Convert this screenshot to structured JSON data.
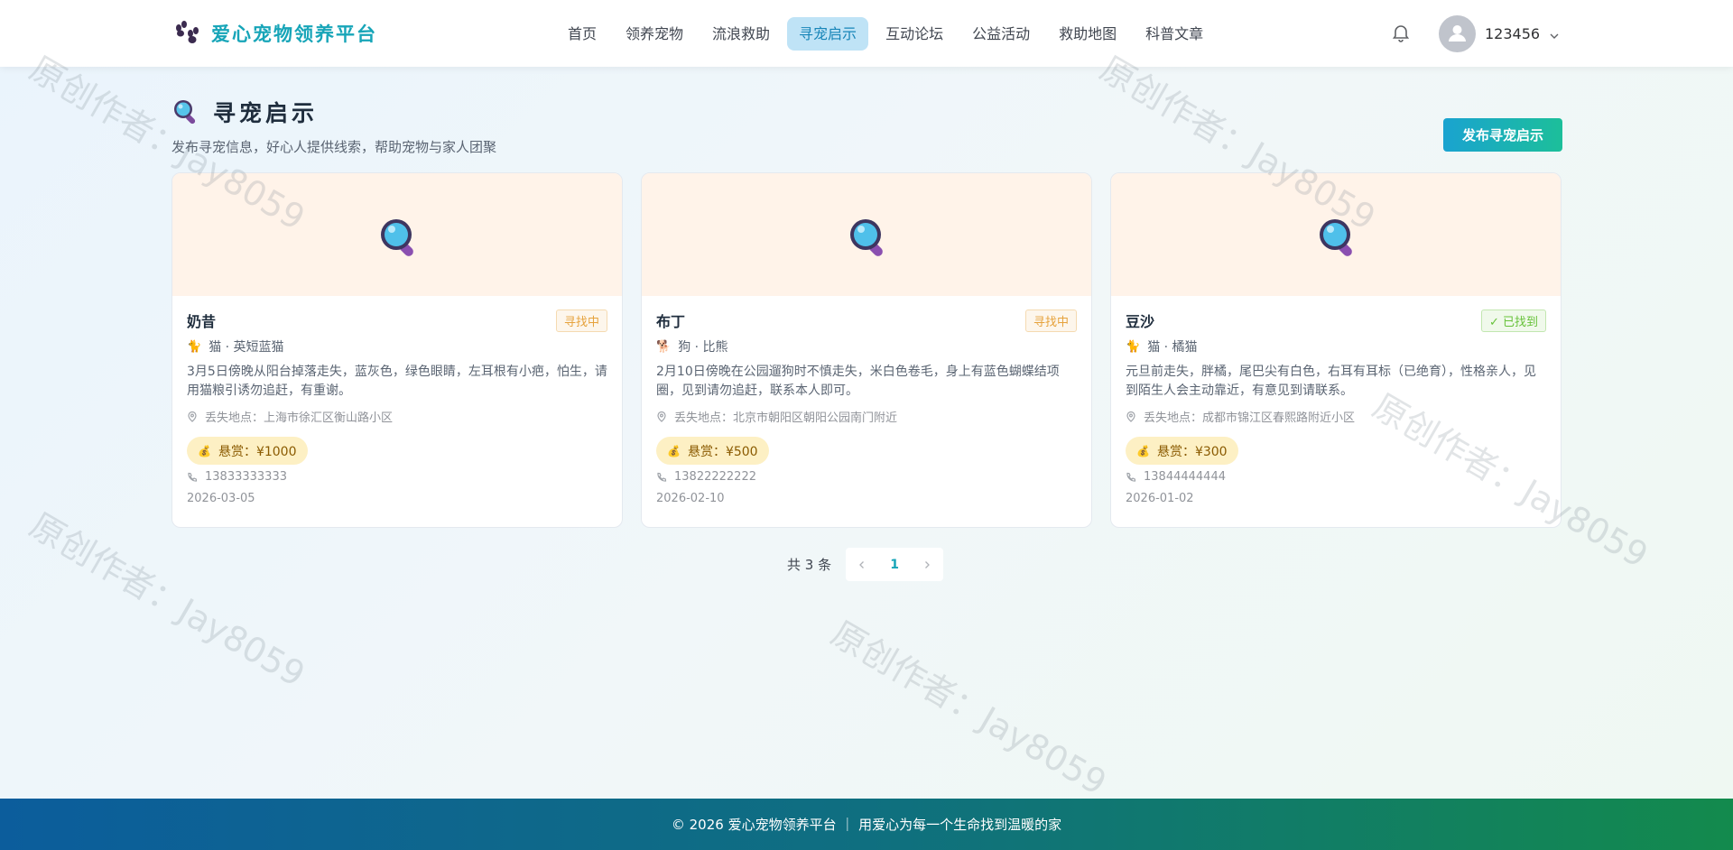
{
  "brand": {
    "name": "爱心宠物领养平台"
  },
  "nav": [
    {
      "label": "首页"
    },
    {
      "label": "领养宠物"
    },
    {
      "label": "流浪救助"
    },
    {
      "label": "寻宠启示",
      "active": true
    },
    {
      "label": "互动论坛"
    },
    {
      "label": "公益活动"
    },
    {
      "label": "救助地图"
    },
    {
      "label": "科普文章"
    }
  ],
  "user": {
    "name": "123456"
  },
  "page": {
    "title": "寻宠启示",
    "subtitle": "发布寻宠信息，好心人提供线索，帮助宠物与家人团聚",
    "publish_button": "发布寻宠启示"
  },
  "cards": [
    {
      "name": "奶昔",
      "status": "寻找中",
      "species": "猫 · 英短蓝猫",
      "description": "3月5日傍晚从阳台掉落走失，蓝灰色，绿色眼睛，左耳根有小疤，怕生，请用猫粮引诱勿追赶，有重谢。",
      "location": "丢失地点：上海市徐汇区衡山路小区",
      "reward": "悬赏：¥1000",
      "phone": "13833333333",
      "date": "2026-03-05"
    },
    {
      "name": "布丁",
      "status": "寻找中",
      "species": "狗 · 比熊",
      "description": "2月10日傍晚在公园遛狗时不慎走失，米白色卷毛，身上有蓝色蝴蝶结项圈，见到请勿追赶，联系本人即可。",
      "location": "丢失地点：北京市朝阳区朝阳公园南门附近",
      "reward": "悬赏：¥500",
      "phone": "13822222222",
      "date": "2026-02-10"
    },
    {
      "name": "豆沙",
      "status": "✓ 已找到",
      "species": "猫 · 橘猫",
      "description": "元旦前走失，胖橘，尾巴尖有白色，右耳有耳标（已绝育），性格亲人，见到陌生人会主动靠近，有意见到请联系。",
      "location": "丢失地点：成都市锦江区春熙路附近小区",
      "reward": "悬赏：¥300",
      "phone": "13844444444",
      "date": "2026-01-02"
    }
  ],
  "pagination": {
    "total": "共 3 条",
    "current": "1"
  },
  "watermark": "原创作者：Jay8059",
  "footer": {
    "text": "© 2026 爱心宠物领养平台 ｜ 用爱心为每一个生命找到温暖的家"
  },
  "colors": {
    "accent": "#17a5b8",
    "nav_active_bg": "#bfe3f6",
    "banner_bg": "#fff3e9"
  }
}
